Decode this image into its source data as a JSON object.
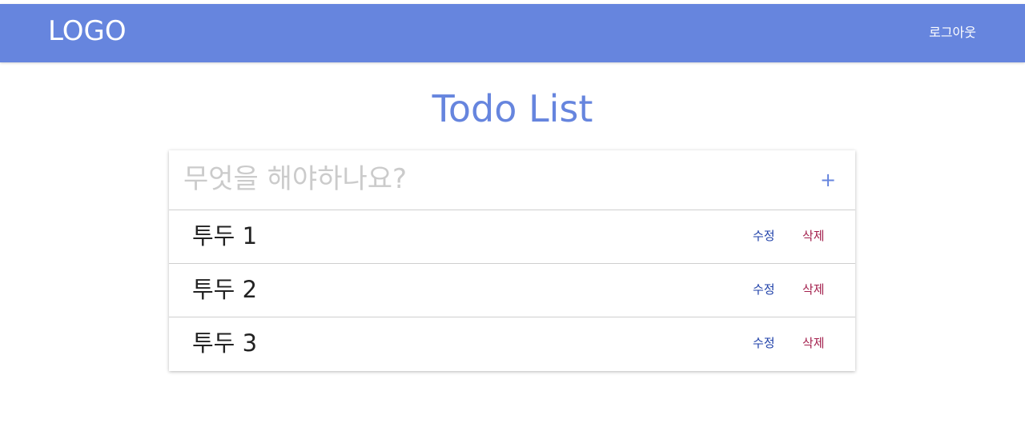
{
  "header": {
    "logo": "LOGO",
    "logout_label": "로그아웃"
  },
  "page_title": "Todo List",
  "new_todo": {
    "placeholder": "무엇을 해야하나요?",
    "value": "",
    "add_label": "+"
  },
  "todos": [
    {
      "text": "투두 1",
      "edit_label": "수정",
      "delete_label": "삭제"
    },
    {
      "text": "투두 2",
      "edit_label": "수정",
      "delete_label": "삭제"
    },
    {
      "text": "투두 3",
      "edit_label": "수정",
      "delete_label": "삭제"
    }
  ],
  "colors": {
    "accent": "#6685de",
    "edit": "#1d3fa8",
    "delete": "#a3204d"
  }
}
